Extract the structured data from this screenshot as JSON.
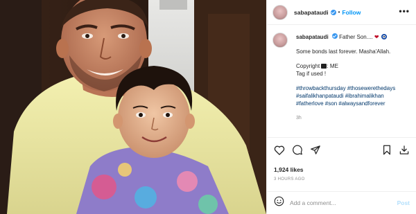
{
  "post": {
    "username": "sabapataudi",
    "follow_label": "Follow",
    "dot": "•",
    "more_label": "•••",
    "caption": {
      "username": "sabapataudi",
      "title": "Father Son....",
      "line1": "Some bonds last forever. Masha'Allah.",
      "copyright_prefix": "Copyright",
      "copyright_suffix": ": ME",
      "tag_line": "Tag if used !",
      "hashtags": [
        "#throwbackthursday #thosewerethedays",
        "#saifalikhanpataudi #ibrahimalikhan",
        "#fatherlove #son #alwaysandforever"
      ],
      "time": "3h"
    },
    "likes": "1,924 likes",
    "posted_ago": "3 HOURS AGO",
    "comment": {
      "placeholder": "Add a comment...",
      "post_label": "Post"
    }
  },
  "icons": {
    "verified": "verified-badge-icon",
    "like": "heart-icon",
    "comment": "comment-bubble-icon",
    "share": "paper-plane-icon",
    "save": "bookmark-icon",
    "download": "download-icon",
    "emoji": "smiley-icon"
  },
  "colors": {
    "link": "#0095f6",
    "hashtag": "#00376b",
    "muted": "#8e8e8e",
    "post_disabled": "#b2dffc"
  }
}
